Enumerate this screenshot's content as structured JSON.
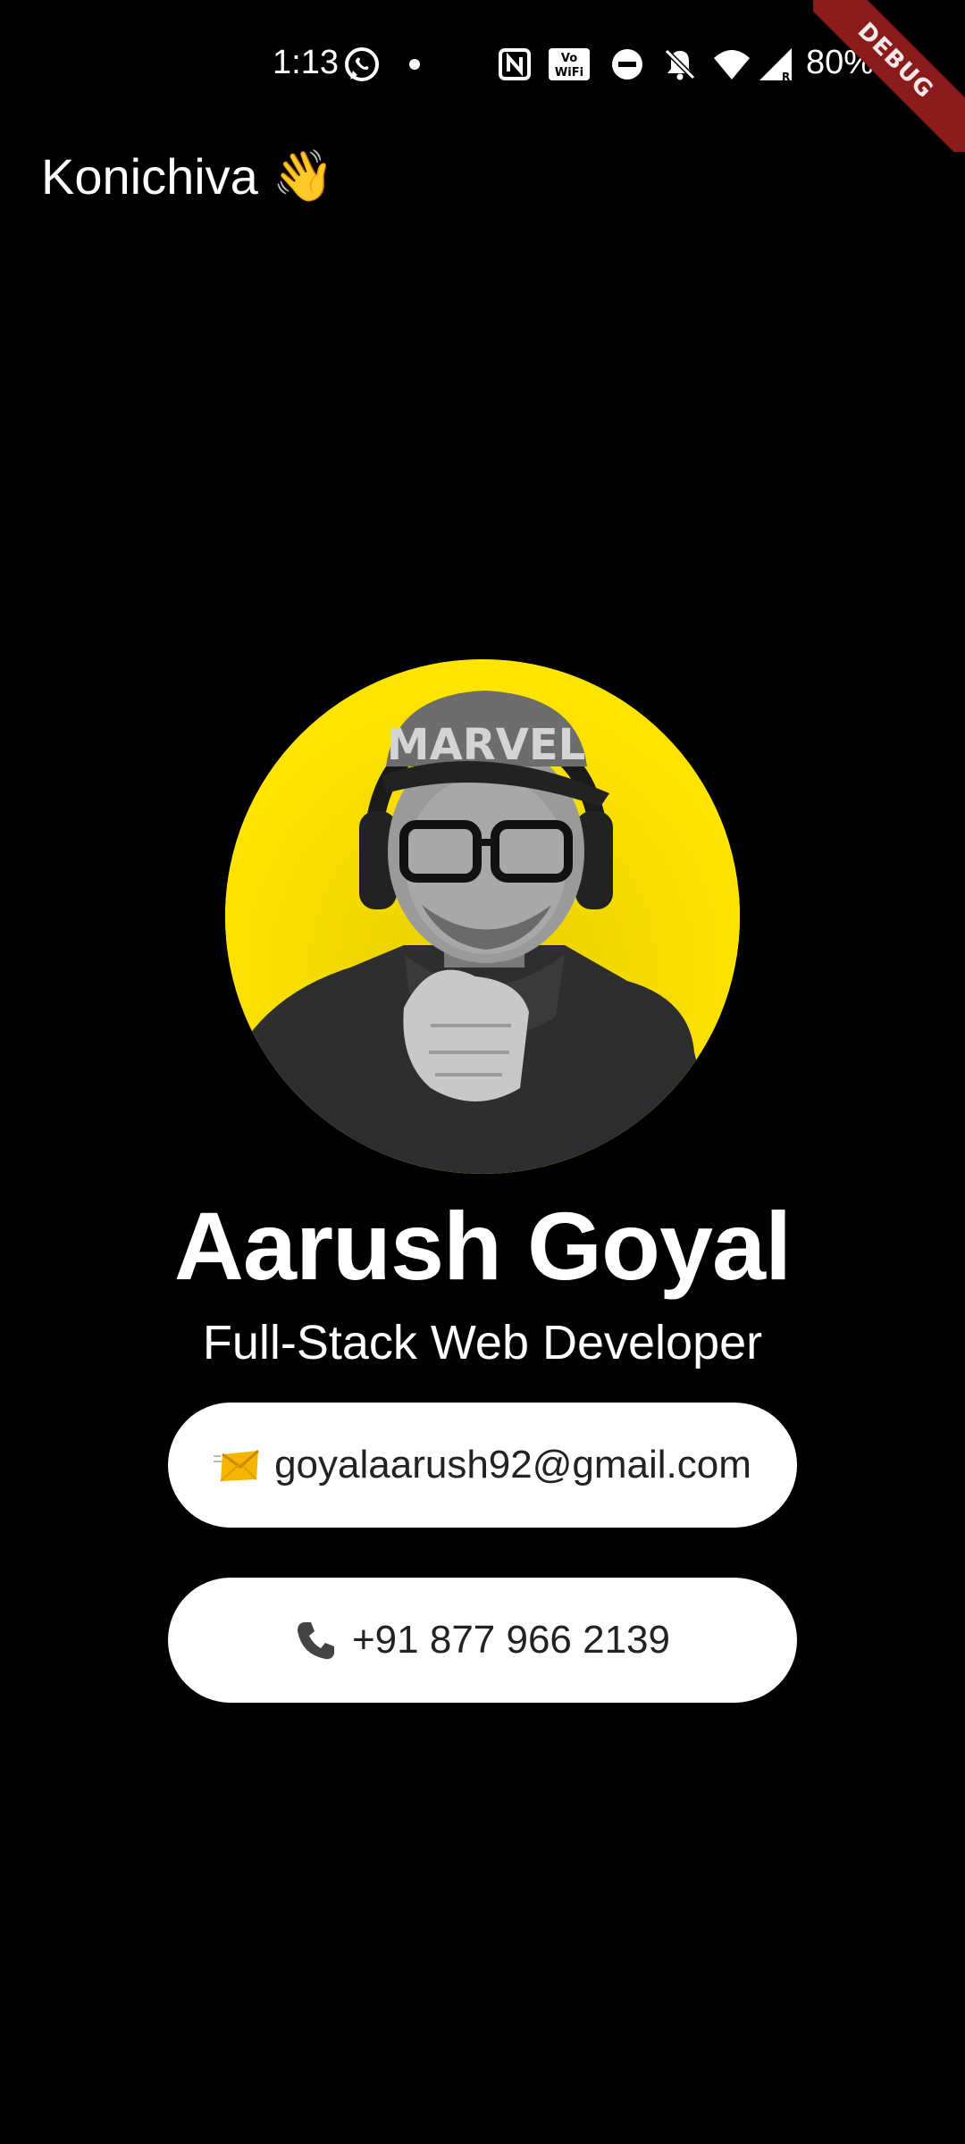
{
  "status_bar": {
    "time": "1:13",
    "battery": "80%"
  },
  "debug_banner": "DEBUG",
  "header": {
    "greeting": "Konichiva",
    "greeting_emoji": "👋"
  },
  "profile": {
    "avatar_icon": "profile-photo",
    "avatar_bg": "#ffe400",
    "name": "Aarush Goyal",
    "title": "Full-Stack Web Developer"
  },
  "contacts": {
    "email": "goyalaarush92@gmail.com",
    "email_icon": "envelope-icon",
    "phone": "+91 877 966 2139",
    "phone_icon": "phone-icon"
  },
  "colors": {
    "background": "#000000",
    "button_bg": "#ffffff",
    "accent_yellow": "#ffe400",
    "debug_red": "#8b1a1a"
  }
}
